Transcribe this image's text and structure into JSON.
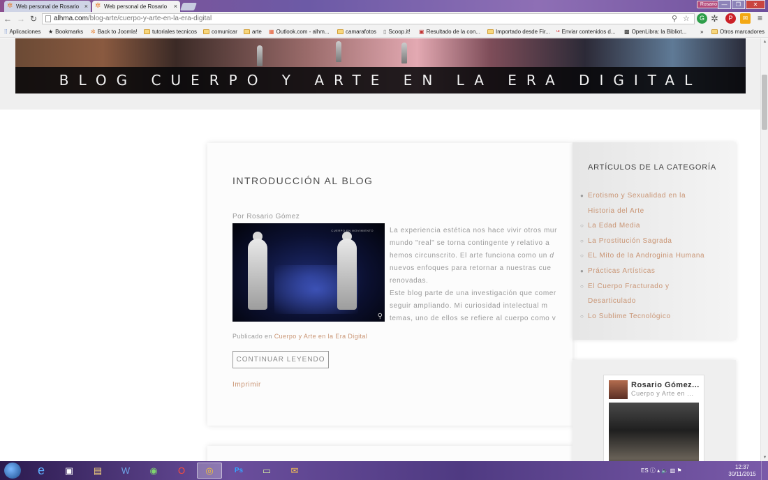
{
  "browser": {
    "tabs": [
      {
        "title": "Web personal de Rosario",
        "active": false
      },
      {
        "title": "Web personal de Rosario",
        "active": true
      }
    ],
    "user_button": "Rosario",
    "url_domain": "alhma.com",
    "url_path": "/blog-arte/cuerpo-y-arte-en-la-era-digital",
    "bookmarks": [
      {
        "label": "Aplicaciones"
      },
      {
        "label": "Bookmarks"
      },
      {
        "label": "Back to Joomla!"
      },
      {
        "label": "tutoriales tecnicos"
      },
      {
        "label": "comunicar"
      },
      {
        "label": "arte"
      },
      {
        "label": "Outlook.com - alhm..."
      },
      {
        "label": "camarafotos"
      },
      {
        "label": "Scoop.it!"
      },
      {
        "label": "Resultado de la con..."
      },
      {
        "label": "Importado desde Fir..."
      },
      {
        "label": "Enviar contenidos d..."
      },
      {
        "label": "OpenLibra: la Bibliot..."
      },
      {
        "label": "»"
      },
      {
        "label": "Otros marcadores"
      }
    ]
  },
  "page": {
    "banner_title": "BLOG CUERPO Y ARTE EN LA ERA DIGITAL",
    "article": {
      "title": "INTRODUCCIÓN AL BLOG",
      "byline": "Por Rosario Gómez",
      "image_caption": "CUERPO EN MOVIMIENTO",
      "body_lines": [
        {
          "text": "La experiencia estética nos hace vivir otros mur"
        },
        {
          "text": "mundo \"real\" se torna contingente y relativo a"
        },
        {
          "text": "hemos circunscrito. El arte funciona como un ",
          "italic": "d"
        },
        {
          "text": "nuevos enfoques para retornar a nuestras cue"
        },
        {
          "text": "renovadas."
        },
        {
          "text": "Este blog parte de una investigación que comer"
        },
        {
          "text": "seguir ampliando. Mi curiosidad intelectual m"
        },
        {
          "text": "temas, uno de ellos se refiere al cuerpo como v"
        }
      ],
      "published_prefix": "Publicado en",
      "published_category": "Cuerpo y Arte en la Era Digital",
      "read_more": "CONTINUAR LEYENDO",
      "print": "Imprimir"
    },
    "sidebar": {
      "title": "ARTÍCULOS DE LA CATEGORÍA",
      "items": [
        {
          "label": "Erotismo y Sexualidad en la",
          "bullet": "filled"
        },
        {
          "label": "Historia del Arte",
          "bullet": "none"
        },
        {
          "label": "La Edad Media",
          "bullet": "hollow"
        },
        {
          "label": "La Prostitución Sagrada",
          "bullet": "hollow"
        },
        {
          "label": "EL Mito de la Androginia Humana",
          "bullet": "hollow"
        },
        {
          "label": "Prácticas Artísticas",
          "bullet": "filled"
        },
        {
          "label": "El Cuerpo Fracturado y",
          "bullet": "hollow"
        },
        {
          "label": "Desarticulado",
          "bullet": "none"
        },
        {
          "label": "Lo Sublime Tecnológico",
          "bullet": "hollow"
        }
      ]
    },
    "profile_card": {
      "name": "Rosario Gómez...",
      "subtitle": "Cuerpo y Arte en ..."
    }
  },
  "taskbar": {
    "language": "ES",
    "time": "12:37",
    "date": "30/11/2015"
  },
  "colors": {
    "link": "#c99473",
    "text_muted": "#9a9a9a"
  }
}
